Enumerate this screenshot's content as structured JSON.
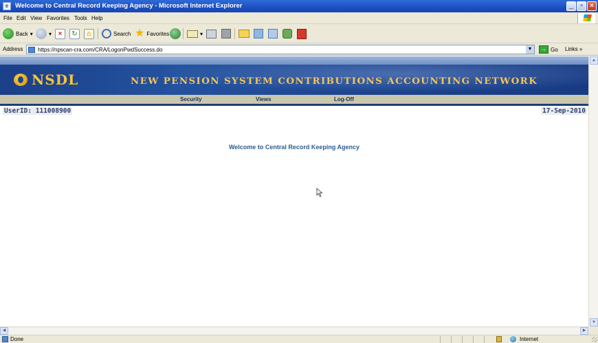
{
  "window": {
    "title": "Welcome to Central Record Keeping Agency - Microsoft Internet Explorer",
    "minimize": "_",
    "maximize": "▫",
    "close": "×"
  },
  "menu": [
    "File",
    "Edit",
    "View",
    "Favorites",
    "Tools",
    "Help"
  ],
  "toolbar": {
    "back_label": "Back",
    "search_label": "Search",
    "favorites_label": "Favorites"
  },
  "address": {
    "label": "Address",
    "url": "https://npscan-cra.com/CRA/LogonPwdSuccess.do",
    "go_label": "Go",
    "links_label": "Links »"
  },
  "page": {
    "logo_text": "NSDL",
    "banner_title": "NEW PENSION SYSTEM CONTRIBUTIONS ACCOUNTING NETWORK",
    "nav": [
      "Security",
      "Views",
      "Log-Off"
    ],
    "userid": "UserID: 111008900",
    "date": "17-Sep-2010",
    "welcome": "Welcome to Central Record Keeping Agency"
  },
  "status": {
    "text": "Done",
    "zone": "Internet"
  },
  "colors": {
    "banner_bg": "#1d4590",
    "banner_text": "#f2c45a",
    "welcome_text": "#2a5c96",
    "titlebar": "#2f6bd8"
  }
}
